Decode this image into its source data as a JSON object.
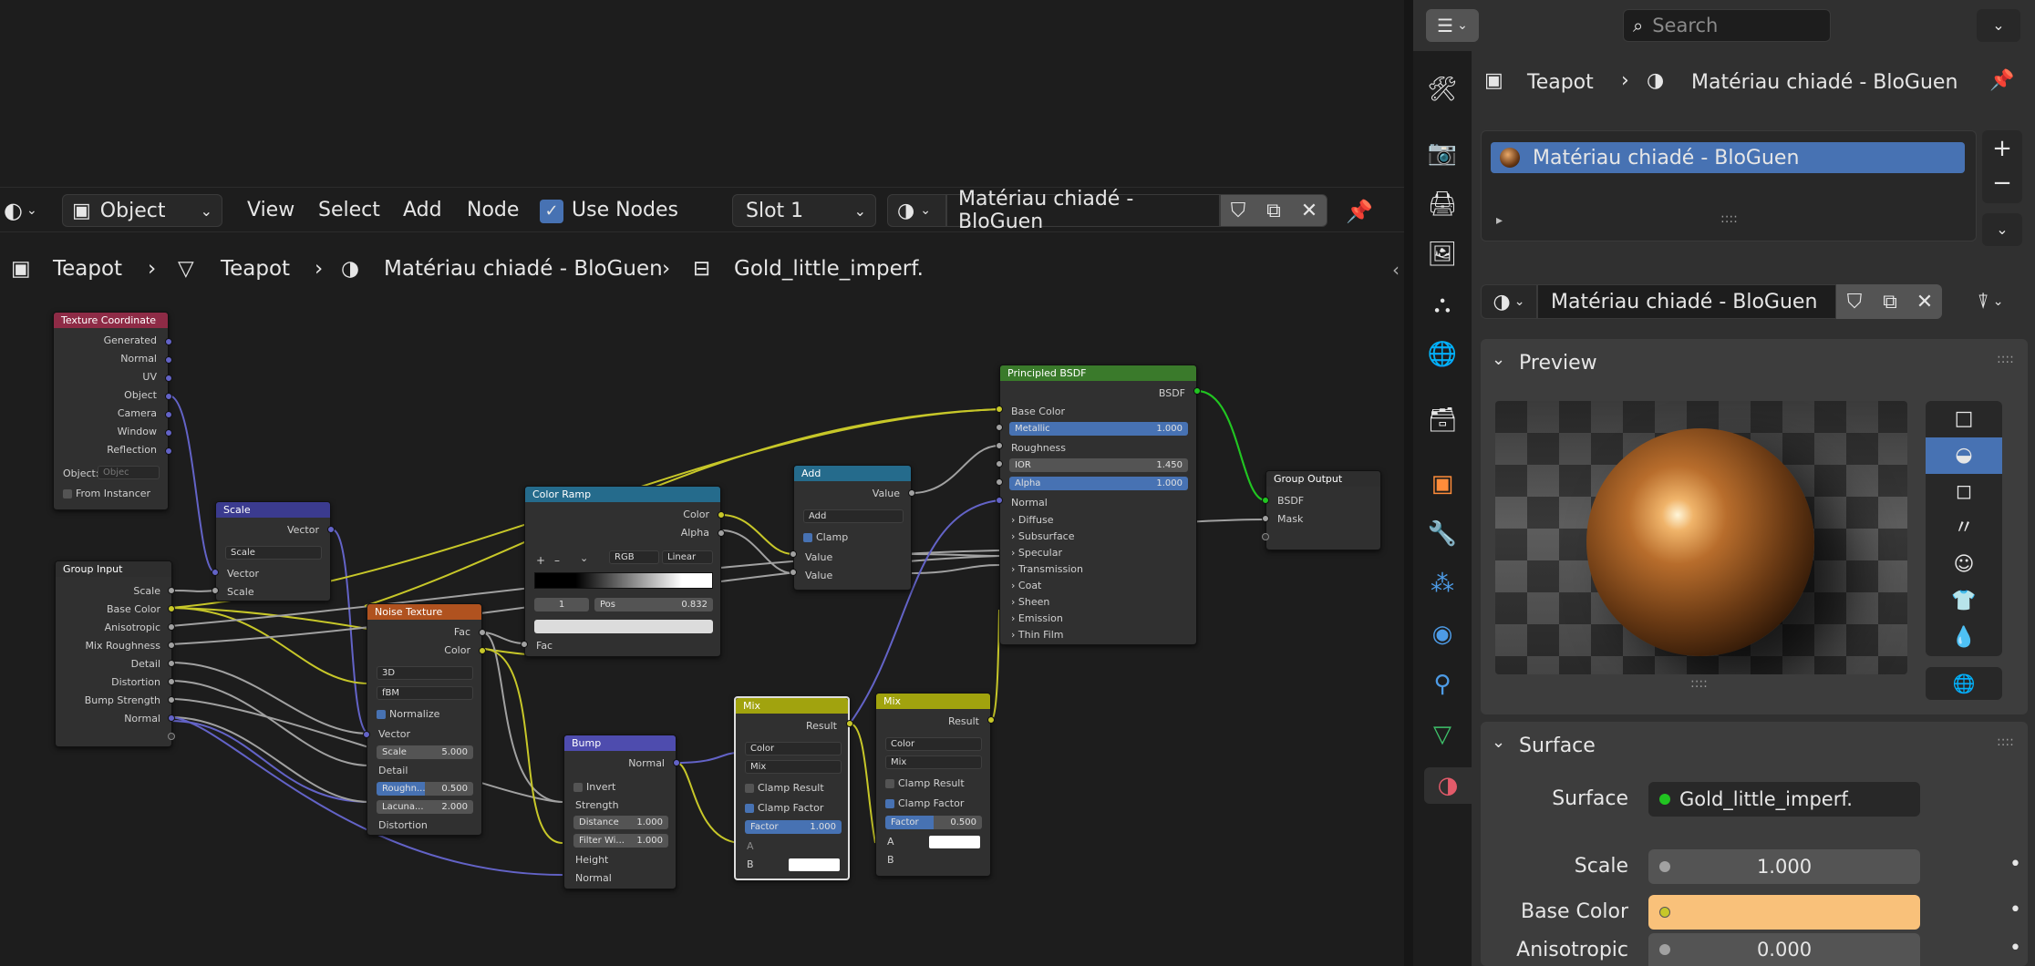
{
  "header": {
    "editor_type_icon": "node-editor-icon",
    "object_mode": "Object",
    "menu": [
      "View",
      "Select",
      "Add",
      "Node"
    ],
    "use_nodes_label": "Use Nodes",
    "use_nodes_checked": true,
    "slot": "Slot 1",
    "material": "Matériau chiadé - BloGuen"
  },
  "breadcrumb": [
    "Teapot",
    "Teapot",
    "Matériau chiadé - BloGuen",
    "Gold_little_imperf."
  ],
  "nodes": {
    "texcoord": {
      "title": "Texture Coordinate",
      "outputs": [
        "Generated",
        "Normal",
        "UV",
        "Object",
        "Camera",
        "Window",
        "Reflection"
      ],
      "object_label": "Object:",
      "object_placeholder": "Objec",
      "instancer": "From Instancer"
    },
    "scale": {
      "title": "Scale",
      "out": "Vector",
      "op": "Scale",
      "in1": "Vector",
      "in2": "Scale"
    },
    "group_input": {
      "title": "Group Input",
      "outputs": [
        "Scale",
        "Base Color",
        "Anisotropic",
        "Mix Roughness",
        "Detail",
        "Distortion",
        "Bump Strength",
        "Normal"
      ]
    },
    "noise": {
      "title": "Noise Texture",
      "out1": "Fac",
      "out2": "Color",
      "dim": "3D",
      "type": "fBM",
      "normalize": "Normalize",
      "vector": "Vector",
      "scale_label": "Scale",
      "scale_val": "5.000",
      "detail": "Detail",
      "rough_label": "Roughn...",
      "rough_val": "0.500",
      "lac_label": "Lacuna...",
      "lac_val": "2.000",
      "distortion": "Distortion"
    },
    "ramp": {
      "title": "Color Ramp",
      "out1": "Color",
      "out2": "Alpha",
      "plus": "+",
      "minus": "–",
      "mode": "RGB",
      "interp": "Linear",
      "index": "1",
      "pos_label": "Pos",
      "pos_val": "0.832",
      "fac": "Fac"
    },
    "add": {
      "title": "Add",
      "out": "Value",
      "op": "Add",
      "clamp": "Clamp",
      "in1": "Value",
      "in2": "Value"
    },
    "bump": {
      "title": "Bump",
      "out": "Normal",
      "invert": "Invert",
      "strength": "Strength",
      "dist_label": "Distance",
      "dist_val": "1.000",
      "filt_label": "Filter Wi...",
      "filt_val": "1.000",
      "height": "Height",
      "normal": "Normal"
    },
    "mix1": {
      "title": "Mix",
      "out": "Result",
      "type": "Color",
      "blend": "Mix",
      "clamp_result": "Clamp Result",
      "clamp_factor": "Clamp Factor",
      "factor_label": "Factor",
      "factor_val": "1.000",
      "a": "A",
      "b": "B"
    },
    "mix2": {
      "title": "Mix",
      "out": "Result",
      "type": "Color",
      "blend": "Mix",
      "clamp_result": "Clamp Result",
      "clamp_factor": "Clamp Factor",
      "factor_label": "Factor",
      "factor_val": "0.500",
      "a": "A",
      "b": "B"
    },
    "bsdf": {
      "title": "Principled BSDF",
      "out": "BSDF",
      "base": "Base Color",
      "metal_label": "Metallic",
      "metal_val": "1.000",
      "rough": "Roughness",
      "ior_label": "IOR",
      "ior_val": "1.450",
      "alpha_label": "Alpha",
      "alpha_val": "1.000",
      "normal": "Normal",
      "panels": [
        "Diffuse",
        "Subsurface",
        "Specular",
        "Transmission",
        "Coat",
        "Sheen",
        "Emission",
        "Thin Film"
      ]
    },
    "output": {
      "title": "Group Output",
      "in1": "BSDF",
      "in2": "Mask"
    }
  },
  "props": {
    "search_placeholder": "Search",
    "crumb_obj": "Teapot",
    "crumb_mat": "Matériau chiadé - BloGuen",
    "slot_item": "Matériau chiadé - BloGuen",
    "material_name": "Matériau chiadé - BloGuen",
    "preview_label": "Preview",
    "surface_panel": "Surface",
    "surface_label": "Surface",
    "surface_val": "Gold_little_imperf.",
    "scale_label": "Scale",
    "scale_val": "1.000",
    "base_label": "Base Color",
    "aniso_label": "Anisotropic",
    "aniso_val": "0.000"
  },
  "colors": {
    "accent": "#4772b3",
    "base_color": "#f9c17a",
    "frame_tex": "#8e2b46",
    "frame_group": "#3b3b8f",
    "frame_conv": "#256b8c",
    "frame_shader": "#3a7a2b",
    "frame_noise": "#b0521f",
    "frame_vector": "#4e4cae",
    "frame_mix": "#a1a30e"
  }
}
